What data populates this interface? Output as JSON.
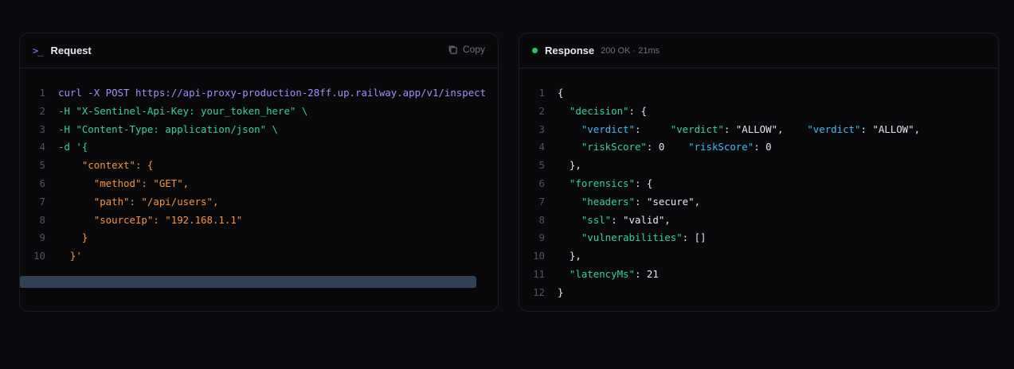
{
  "request": {
    "title": "Request",
    "icon": "terminal-icon",
    "copy_label": "Copy",
    "lines": [
      {
        "n": "1",
        "t": "curl -X POST https://api-proxy-production-28ff.up.railway.app/v1/inspect",
        "c": "c-cmd"
      },
      {
        "n": "2",
        "t": "-H \"X-Sentinel-Api-Key: your_token_here\" \\",
        "c": "c-green"
      },
      {
        "n": "3",
        "t": "-H \"Content-Type: application/json\" \\",
        "c": "c-green"
      },
      {
        "n": "4",
        "t": "-d '{",
        "c": "c-green"
      },
      {
        "n": "5",
        "t": "    \"context\": {",
        "c": "c-orange"
      },
      {
        "n": "6",
        "t": "      \"method\": \"GET\",",
        "c": "c-orange"
      },
      {
        "n": "7",
        "t": "      \"path\": \"/api/users\",",
        "c": "c-orange"
      },
      {
        "n": "8",
        "t": "      \"sourceIp\": \"192.168.1.1\"",
        "c": "c-orange"
      },
      {
        "n": "9",
        "t": "    }",
        "c": "c-orange"
      },
      {
        "n": "10",
        "t": "  }'",
        "c": "c-orange"
      }
    ]
  },
  "response": {
    "title": "Response",
    "status": "200 OK · 21ms",
    "status_color": "#22c55e",
    "lines": [
      {
        "n": "1",
        "parts": [
          {
            "t": "{",
            "c": "c-white"
          }
        ]
      },
      {
        "n": "2",
        "parts": [
          {
            "t": "  \"decision\"",
            "c": "c-key"
          },
          {
            "t": ": {",
            "c": "c-white"
          }
        ]
      },
      {
        "n": "3",
        "parts": [
          {
            "t": "    \"verdict\"",
            "c": "c-blue"
          },
          {
            "t": ":     ",
            "c": "c-white"
          },
          {
            "t": "\"verdict\"",
            "c": "c-key"
          },
          {
            "t": ": \"ALLOW\",    ",
            "c": "c-white"
          },
          {
            "t": "\"verdict\"",
            "c": "c-blue"
          },
          {
            "t": ": \"ALLOW\",",
            "c": "c-white"
          }
        ]
      },
      {
        "n": "4",
        "parts": [
          {
            "t": "    \"riskScore\"",
            "c": "c-key"
          },
          {
            "t": ": 0    ",
            "c": "c-white"
          },
          {
            "t": "\"riskScore\"",
            "c": "c-blue"
          },
          {
            "t": ": 0",
            "c": "c-white"
          }
        ]
      },
      {
        "n": "5",
        "parts": [
          {
            "t": "  },",
            "c": "c-white"
          }
        ]
      },
      {
        "n": "6",
        "parts": [
          {
            "t": "  \"forensics\"",
            "c": "c-key"
          },
          {
            "t": ": {",
            "c": "c-white"
          }
        ]
      },
      {
        "n": "7",
        "parts": [
          {
            "t": "    \"headers\"",
            "c": "c-key"
          },
          {
            "t": ": \"secure\",",
            "c": "c-white"
          }
        ]
      },
      {
        "n": "8",
        "parts": [
          {
            "t": "    \"ssl\"",
            "c": "c-key"
          },
          {
            "t": ": \"valid\",",
            "c": "c-white"
          }
        ]
      },
      {
        "n": "9",
        "parts": [
          {
            "t": "    \"vulnerabilities\"",
            "c": "c-key"
          },
          {
            "t": ": []",
            "c": "c-white"
          }
        ]
      },
      {
        "n": "10",
        "parts": [
          {
            "t": "  },",
            "c": "c-white"
          }
        ]
      },
      {
        "n": "11",
        "parts": [
          {
            "t": "  \"latencyMs\"",
            "c": "c-key"
          },
          {
            "t": ": 21",
            "c": "c-white"
          }
        ]
      },
      {
        "n": "12",
        "parts": [
          {
            "t": "}",
            "c": "c-white"
          }
        ]
      }
    ]
  }
}
